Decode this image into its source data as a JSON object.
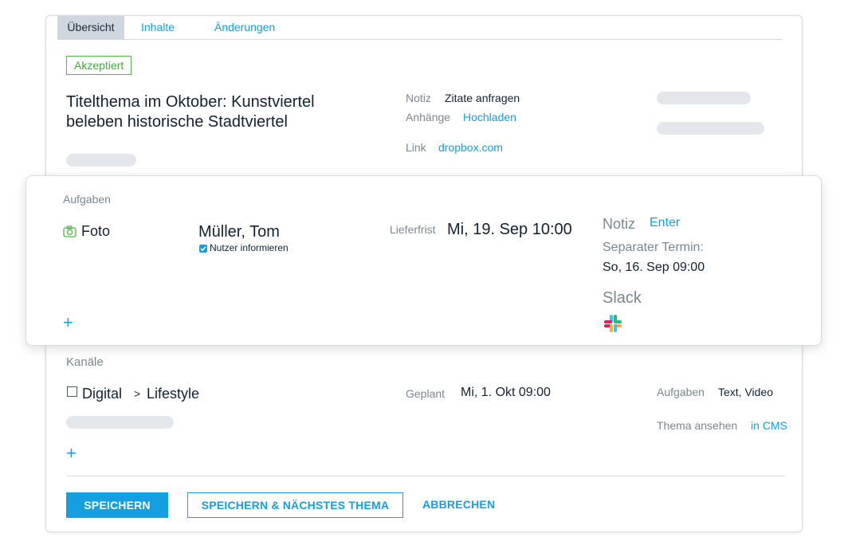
{
  "tabs": [
    "Übersicht",
    "Inhalte",
    "Änderungen"
  ],
  "status_badge": "Akzeptiert",
  "topic_title": "Titelthema im Oktober: Kunstviertel beleben historische Stadtviertel",
  "meta": {
    "note_label": "Notiz",
    "note_value": "Zitate anfragen",
    "attachments_label": "Anhänge",
    "attachments_action": "Hochladen",
    "link_label": "Link",
    "link_value": "dropbox.com"
  },
  "tasks": {
    "section_label": "Aufgaben",
    "task_type": "Foto",
    "assignee": "Müller, Tom",
    "notify_label": "Nutzer informieren",
    "deadline_label": "Lieferfrist",
    "deadline_value": "Mi, 19. Sep 10:00",
    "note_label": "Notiz",
    "note_action": "Enter",
    "separate_label": "Separater Termin:",
    "separate_value": "So, 16. Sep 09:00",
    "slack_label": "Slack",
    "add_symbol": "+"
  },
  "channels": {
    "section_label": "Kanäle",
    "channel_name": "Digital",
    "arrow": ">",
    "sub_channel": "Lifestyle",
    "planned_label": "Geplant",
    "planned_value": "Mi, 1. Okt 09:00",
    "tasks_label": "Aufgaben",
    "tasks_value": "Text, Video",
    "view_label": "Thema ansehen",
    "view_link": "in CMS",
    "add_symbol": "+"
  },
  "actions": {
    "save": "SPEICHERN",
    "save_next": "SPEICHERN & NÄCHSTES THEMA",
    "cancel": "ABBRECHEN"
  },
  "colors": {
    "accent": "#159ee0",
    "accepted_green": "#44a83c",
    "placeholder": "#e3e7eb"
  }
}
